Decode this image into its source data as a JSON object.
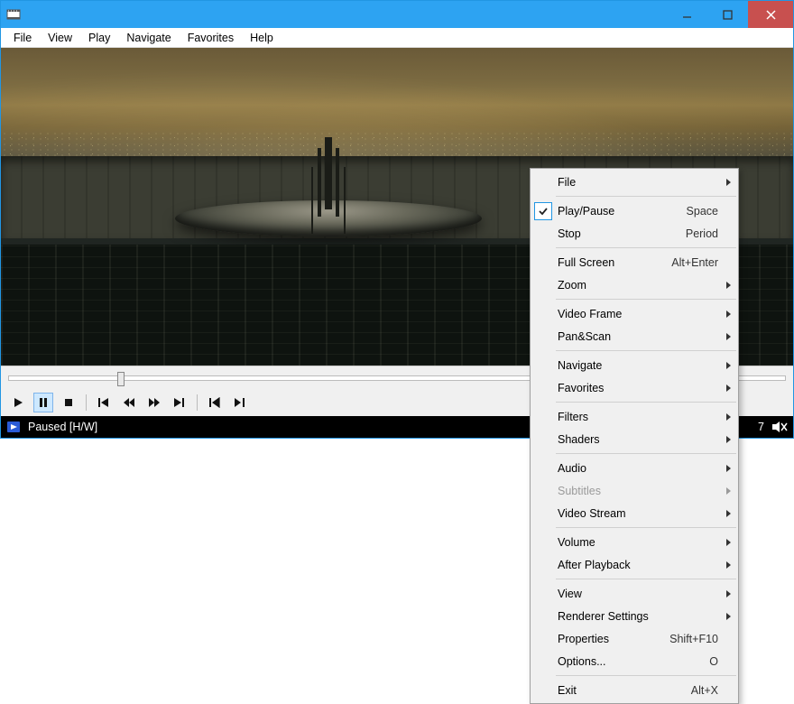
{
  "menubar": [
    "File",
    "View",
    "Play",
    "Navigate",
    "Favorites",
    "Help"
  ],
  "status": {
    "text": "Paused [H/W]",
    "right_number": "7"
  },
  "context_menu": [
    {
      "type": "item",
      "label": "File",
      "submenu": true
    },
    {
      "type": "sep"
    },
    {
      "type": "item",
      "label": "Play/Pause",
      "accel": "Space",
      "checked": true
    },
    {
      "type": "item",
      "label": "Stop",
      "accel": "Period"
    },
    {
      "type": "sep"
    },
    {
      "type": "item",
      "label": "Full Screen",
      "accel": "Alt+Enter"
    },
    {
      "type": "item",
      "label": "Zoom",
      "submenu": true
    },
    {
      "type": "sep"
    },
    {
      "type": "item",
      "label": "Video Frame",
      "submenu": true
    },
    {
      "type": "item",
      "label": "Pan&Scan",
      "submenu": true
    },
    {
      "type": "sep"
    },
    {
      "type": "item",
      "label": "Navigate",
      "submenu": true
    },
    {
      "type": "item",
      "label": "Favorites",
      "submenu": true
    },
    {
      "type": "sep"
    },
    {
      "type": "item",
      "label": "Filters",
      "submenu": true
    },
    {
      "type": "item",
      "label": "Shaders",
      "submenu": true
    },
    {
      "type": "sep"
    },
    {
      "type": "item",
      "label": "Audio",
      "submenu": true
    },
    {
      "type": "item",
      "label": "Subtitles",
      "submenu": true,
      "disabled": true
    },
    {
      "type": "item",
      "label": "Video Stream",
      "submenu": true
    },
    {
      "type": "sep"
    },
    {
      "type": "item",
      "label": "Volume",
      "submenu": true
    },
    {
      "type": "item",
      "label": "After Playback",
      "submenu": true
    },
    {
      "type": "sep"
    },
    {
      "type": "item",
      "label": "View",
      "submenu": true
    },
    {
      "type": "item",
      "label": "Renderer Settings",
      "submenu": true
    },
    {
      "type": "item",
      "label": "Properties",
      "accel": "Shift+F10"
    },
    {
      "type": "item",
      "label": "Options...",
      "accel": "O"
    },
    {
      "type": "sep"
    },
    {
      "type": "item",
      "label": "Exit",
      "accel": "Alt+X"
    }
  ],
  "controls": {
    "play": "play-icon",
    "pause": "pause-icon",
    "stop": "stop-icon",
    "skip_back": "skip-back-icon",
    "rewind": "rewind-icon",
    "forward": "forward-icon",
    "skip_fwd": "skip-forward-icon",
    "step_back": "step-back-icon",
    "step_fwd": "step-forward-icon"
  }
}
